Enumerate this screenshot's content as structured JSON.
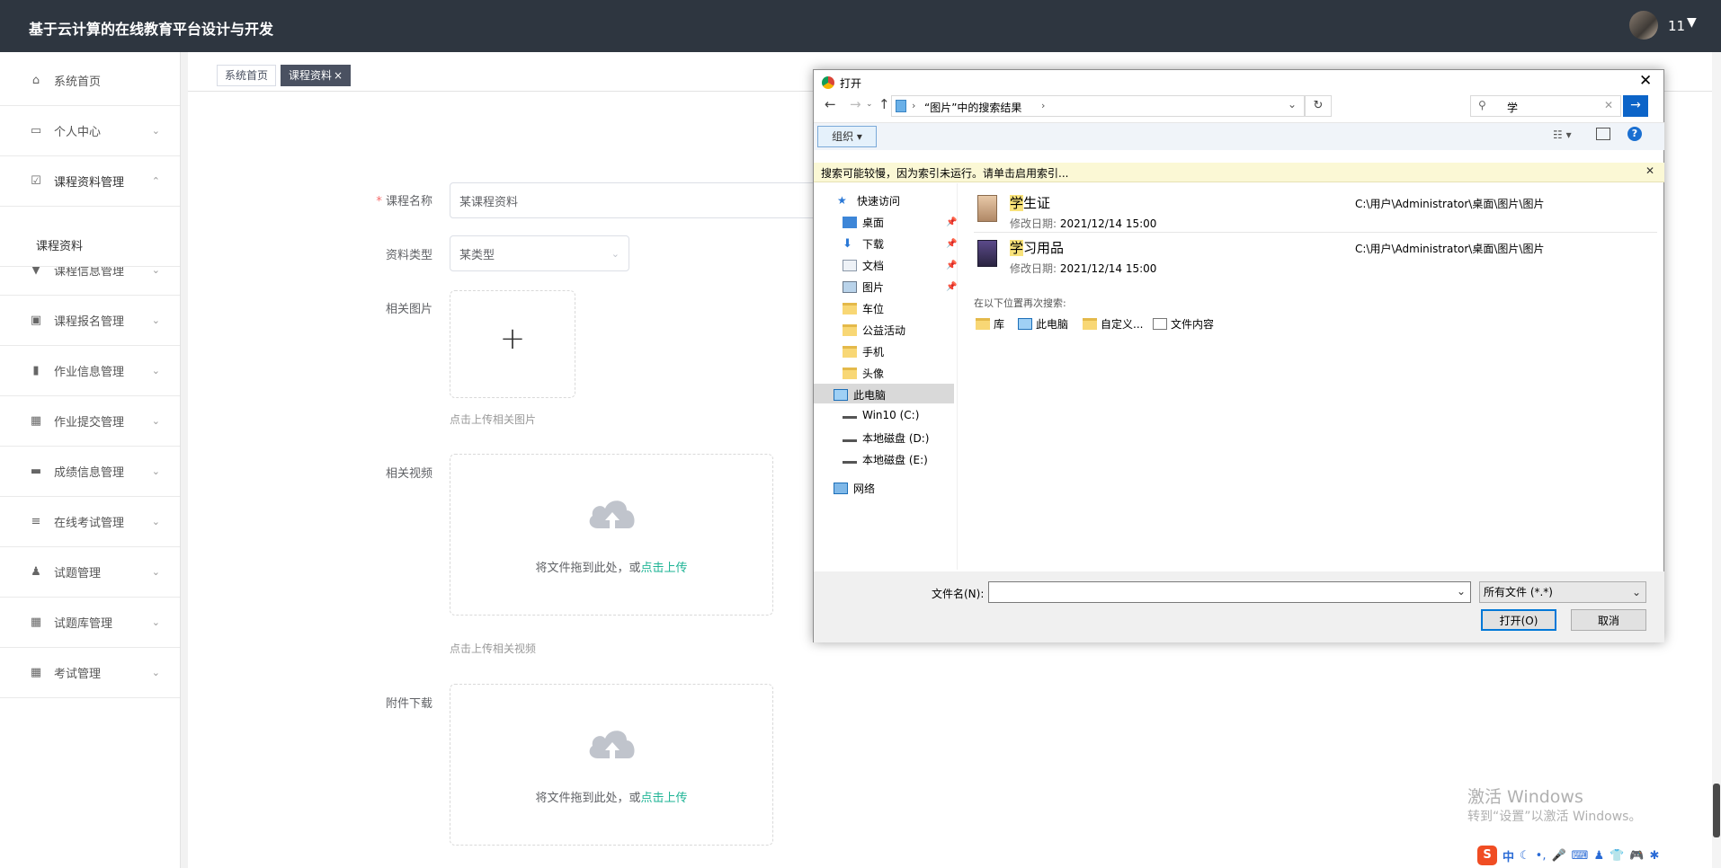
{
  "app": {
    "title": "基于云计算的在线教育平台设计与开发",
    "user": "11"
  },
  "sidebar": {
    "items": [
      {
        "label": "系统首页",
        "icon": "home-icon"
      },
      {
        "label": "个人中心",
        "icon": "card-icon"
      },
      {
        "label": "课程资料管理",
        "icon": "checkbox-icon"
      },
      {
        "label": "课程信息管理",
        "icon": "pin-icon"
      },
      {
        "label": "课程报名管理",
        "icon": "clipboard-icon"
      },
      {
        "label": "作业信息管理",
        "icon": "bar-chart-icon"
      },
      {
        "label": "作业提交管理",
        "icon": "grid-icon"
      },
      {
        "label": "成绩信息管理",
        "icon": "briefcase-icon"
      },
      {
        "label": "在线考试管理",
        "icon": "list-icon"
      },
      {
        "label": "试题管理",
        "icon": "user-icon"
      },
      {
        "label": "试题库管理",
        "icon": "apps-icon"
      },
      {
        "label": "考试管理",
        "icon": "apps-icon"
      }
    ],
    "sub_item": "课程资料"
  },
  "tabs": [
    {
      "label": "系统首页"
    },
    {
      "label": "课程资料",
      "close": "×"
    }
  ],
  "form": {
    "course_name_label": "课程名称",
    "course_name_required": "*",
    "course_name_value": "某课程资料",
    "type_label": "资料类型",
    "type_value": "某类型",
    "image_label": "相关图片",
    "image_plus": "+",
    "image_hint": "点击上传相关图片",
    "video_label": "相关视频",
    "video_drop": "将文件拖到此处，或",
    "video_link": "点击上传",
    "video_hint": "点击上传相关视频",
    "attach_label": "附件下载",
    "attach_drop": "将文件拖到此处，或",
    "attach_link": "点击上传"
  },
  "dialog": {
    "title": "打开",
    "breadcrumb": "“图片”中的搜索结果",
    "search_value": "学",
    "organize": "组织 ▾",
    "info_bar": "搜索可能较慢，因为索引未运行。请单击启用索引...",
    "nav": {
      "quick_access": "快速访问",
      "items": [
        "桌面",
        "下载",
        "文档",
        "图片",
        "车位",
        "公益活动",
        "手机",
        "头像"
      ],
      "this_pc": "此电脑",
      "drives": [
        "Win10 (C:)",
        "本地磁盘 (D:)",
        "本地磁盘 (E:)"
      ],
      "network": "网络"
    },
    "results": [
      {
        "title_hl": "学",
        "title_rest": "生证",
        "date_label": "修改日期:",
        "date": "2021/12/14 15:00",
        "path": "C:\\用户\\Administrator\\桌面\\图片\\图片"
      },
      {
        "title_hl": "学",
        "title_rest": "习用品",
        "date_label": "修改日期:",
        "date": "2021/12/14 15:00",
        "path": "C:\\用户\\Administrator\\桌面\\图片\\图片"
      }
    ],
    "search_again_label": "在以下位置再次搜索:",
    "search_again": [
      "库",
      "此电脑",
      "自定义...",
      "文件内容"
    ],
    "filename_label": "文件名(N):",
    "filename_value": "",
    "filetype": "所有文件 (*.*)",
    "open_button": "打开(O)",
    "cancel_button": "取消"
  },
  "watermark": {
    "line1": "激活 Windows",
    "line2": "转到“设置”以激活 Windows。"
  },
  "tray": {
    "ime": "中"
  }
}
